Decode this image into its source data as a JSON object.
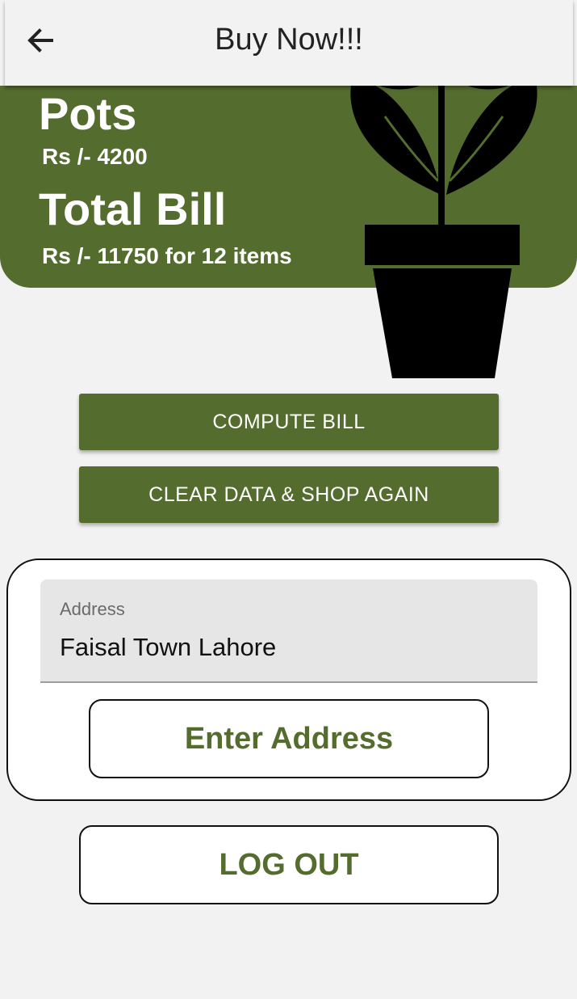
{
  "appbar": {
    "title": "Buy Now!!!",
    "back_icon": "arrow-left-icon"
  },
  "summary": {
    "item_title": "Pots",
    "item_price": "Rs /- 4200",
    "bill_title": "Total Bill",
    "bill_summary": "Rs /- 11750 for 12 items",
    "illustration": "potted-plant-icon"
  },
  "buttons": {
    "compute": "COMPUTE BILL",
    "clear": "CLEAR DATA & SHOP AGAIN",
    "enter_address": "Enter Address",
    "logout": "LOG OUT"
  },
  "address": {
    "label": "Address",
    "value": "Faisal Town Lahore"
  },
  "colors": {
    "primary": "#546c2e",
    "background": "#f2f2f2",
    "field": "#e6e6e6"
  }
}
